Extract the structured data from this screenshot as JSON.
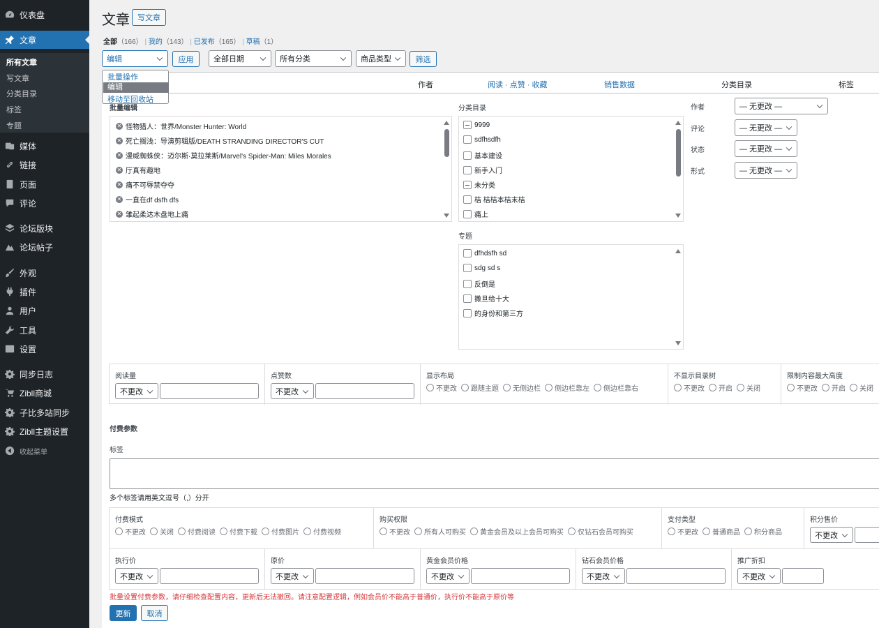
{
  "sidebar": {
    "items": [
      {
        "label": "仪表盘",
        "icon": "dashboard-icon"
      },
      {
        "label": "文章",
        "icon": "pushpin-icon"
      },
      {
        "label": "媒体",
        "icon": "media-icon"
      },
      {
        "label": "链接",
        "icon": "link-icon"
      },
      {
        "label": "页面",
        "icon": "page-icon"
      },
      {
        "label": "评论",
        "icon": "comment-icon"
      },
      {
        "label": "论坛版块",
        "icon": "layers-icon"
      },
      {
        "label": "论坛帖子",
        "icon": "forum-icon"
      },
      {
        "label": "外观",
        "icon": "brush-icon"
      },
      {
        "label": "插件",
        "icon": "plugin-icon"
      },
      {
        "label": "用户",
        "icon": "user-icon"
      },
      {
        "label": "工具",
        "icon": "wrench-icon"
      },
      {
        "label": "设置",
        "icon": "settings-icon"
      },
      {
        "label": "同步日志",
        "icon": "gear-icon"
      },
      {
        "label": "Zibll商城",
        "icon": "cart-icon"
      },
      {
        "label": "子比多站同步",
        "icon": "gear-icon"
      },
      {
        "label": "Zibll主题设置",
        "icon": "gear-icon"
      },
      {
        "label": "收起菜单",
        "icon": "collapse-icon"
      }
    ],
    "submenu": [
      "所有文章",
      "写文章",
      "分类目录",
      "标签",
      "专题"
    ]
  },
  "header": {
    "title": "文章",
    "add_new": "写文章"
  },
  "filters": {
    "all": "全部",
    "all_count": "（166）",
    "mine": "我的",
    "mine_count": "（143）",
    "published": "已发布",
    "published_count": "（165）",
    "draft": "草稿",
    "draft_count": "（1）",
    "sep": "|"
  },
  "toolbar": {
    "bulk_value": "编辑",
    "apply": "应用",
    "date": "全部日期",
    "category": "所有分类",
    "product_type": "商品类型",
    "filter": "筛选",
    "dropdown_options": [
      "批量操作",
      "编辑",
      "移动至回收站"
    ]
  },
  "columns": {
    "author": "作者",
    "views": "阅读 · 点赞 · 收藏",
    "sales": "销售数据",
    "categories": "分类目录",
    "tags": "标签"
  },
  "bulk": {
    "title": "批量编辑",
    "posts": [
      "怪物猎人：世界/Monster Hunter: World",
      "死亡搁浅：导演剪辑版/DEATH STRANDING DIRECTOR'S CUT",
      "漫威蜘蛛侠：迈尔斯·莫拉莱斯/Marvel's Spider-Man: Miles Morales",
      "厅真有趣地",
      "痛不可辱禁夺夺",
      "一直在df dsfh dfs",
      "雏起柔达木盘地上痛"
    ],
    "categories_label": "分类目录",
    "categories": [
      {
        "label": "9999",
        "state": "minus"
      },
      {
        "label": "sdfhsdfh",
        "state": "empty"
      },
      {
        "label": "基本建设",
        "state": "empty"
      },
      {
        "label": "新手入门",
        "state": "empty"
      },
      {
        "label": "未分类",
        "state": "minus"
      },
      {
        "label": "桔 桔桔本桔末桔",
        "state": "empty"
      },
      {
        "label": "痛上",
        "state": "empty"
      }
    ],
    "topics_label": "专题",
    "topics": [
      "dfhdsfh sd",
      "sdg sd s",
      "反倒是",
      "撒旦给十大",
      "的身份和第三方"
    ],
    "fields": [
      {
        "label": "作者",
        "value": "— 无更改 —"
      },
      {
        "label": "评论",
        "value": "— 无更改 —"
      },
      {
        "label": "状态",
        "value": "— 无更改 —"
      },
      {
        "label": "形式",
        "value": "— 无更改 —"
      }
    ]
  },
  "row1": {
    "views": "阅读量",
    "likes": "点赞数",
    "no_change": "不更改",
    "layout": "显示布局",
    "layout_opts": [
      "不更改",
      "跟随主题",
      "无侧边栏",
      "侧边栏靠左",
      "侧边栏靠右"
    ],
    "toc": "不显示目录树",
    "toc_opts": [
      "不更改",
      "开启",
      "关闭"
    ],
    "maxh": "限制内容最大高度",
    "maxh_opts": [
      "不更改",
      "开启",
      "关闭"
    ]
  },
  "pay": {
    "title": "付费参数",
    "tags_label": "标签",
    "tags_hint": "多个标签请用英文逗号（,）分开",
    "mode": "付费模式",
    "mode_opts": [
      "不更改",
      "关闭",
      "付费阅读",
      "付费下载",
      "付费图片",
      "付费视频"
    ],
    "perm": "购买权限",
    "perm_opts": [
      "不更改",
      "所有人可购买",
      "黄金会员及以上会员可购买",
      "仅钻石会员可购买"
    ],
    "paytype": "支付类型",
    "paytype_opts": [
      "不更改",
      "普通商品",
      "积分商品"
    ],
    "points": "积分售价",
    "exec": "执行价",
    "orig": "原价",
    "gold": "黄金会员价格",
    "diamond": "钻石会员价格",
    "promo": "推广折扣",
    "no_change": "不更改",
    "warning": "批量设置付费参数，请仔细检查配置内容，更新后无法撤回。请注意配置逻辑，例如会员价不能高于普通价，执行价不能高于原价等",
    "update": "更新",
    "cancel": "取消"
  }
}
